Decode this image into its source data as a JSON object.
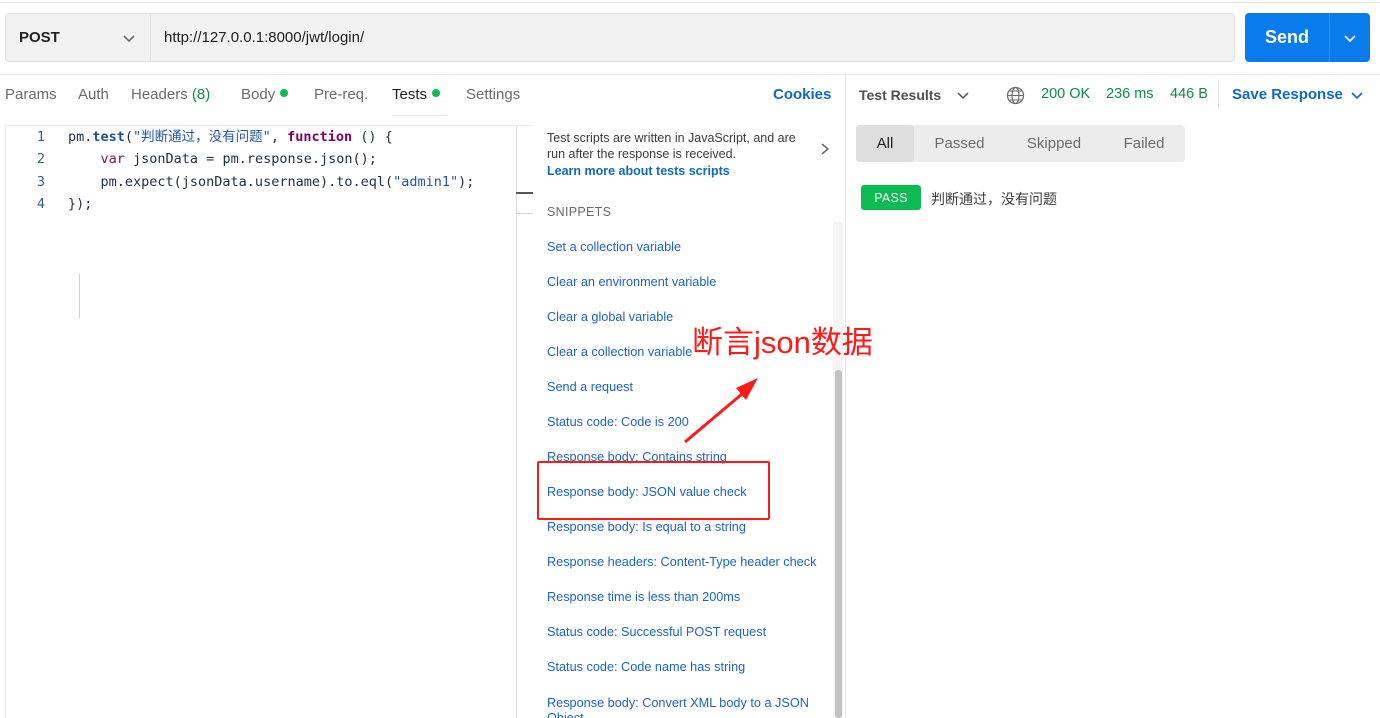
{
  "request": {
    "method": "POST",
    "url": "http://127.0.0.1:8000/jwt/login/",
    "send_label": "Send"
  },
  "tabs": [
    {
      "label": "Params"
    },
    {
      "label": "Auth"
    },
    {
      "label": "Headers",
      "count": "(8)"
    },
    {
      "label": "Body"
    },
    {
      "label": "Pre-req."
    },
    {
      "label": "Tests"
    },
    {
      "label": "Settings"
    }
  ],
  "cookies_label": "Cookies",
  "editor": {
    "line_numbers": [
      "1",
      "2",
      "3",
      "4"
    ]
  },
  "snippets_panel": {
    "help_text": "Test scripts are written in JavaScript, and are run after the response is received.",
    "help_link": "Learn more about tests scripts",
    "title": "SNIPPETS",
    "items": [
      "Set a collection variable",
      "Clear an environment variable",
      "Clear a global variable",
      "Clear a collection variable",
      "Send a request",
      "Status code: Code is 200",
      "Response body: Contains string",
      "Response body: JSON value check",
      "Response body: Is equal to a string",
      "Response headers: Content-Type header check",
      "Response time is less than 200ms",
      "Status code: Successful POST request",
      "Status code: Code name has string",
      "Response body: Convert XML body to a JSON Object"
    ]
  },
  "annotation": {
    "text": "断言json数据"
  },
  "response": {
    "title": "Test Results",
    "status": "200 OK",
    "time": "236 ms",
    "size": "446 B",
    "save_label": "Save Response",
    "filters": [
      "All",
      "Passed",
      "Skipped",
      "Failed"
    ],
    "results": [
      {
        "badge": "PASS",
        "name": "判断通过，没有问题"
      }
    ]
  },
  "colors": {
    "accent": "#097bed",
    "pass": "#0cbb52",
    "status_ok": "#0f8a4a",
    "link": "#0e69c4",
    "annotation": "#ff1a1a"
  }
}
